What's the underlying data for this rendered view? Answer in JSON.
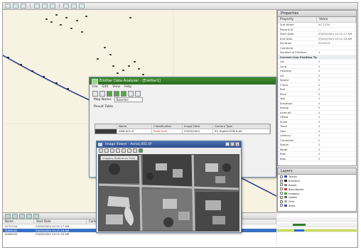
{
  "map": {
    "title": "Map view"
  },
  "props": {
    "title": "Properties",
    "col_property": "Property",
    "col_value": "Value",
    "rows": [
      {
        "k": "Sub Name",
        "v": "AC 1234",
        "sec": false
      },
      {
        "k": "Record ID",
        "v": "---",
        "sec": false
      },
      {
        "k": "Start Date",
        "v": "03/05/2004 10:21:17 AM",
        "sec": false
      },
      {
        "k": "End Date",
        "v": "03/05/2004 10:21:18 AM",
        "sec": false
      },
      {
        "k": "Duration",
        "v": "00:00:01",
        "sec": false
      },
      {
        "k": "Comment",
        "v": "",
        "sec": false
      },
      {
        "k": "Number of Emitters",
        "v": "1",
        "sec": false
      },
      {
        "k": "Current Line Position Type",
        "v": "",
        "sec": true
      },
      {
        "k": "Lat",
        "v": "0",
        "sec": false
      },
      {
        "k": "Long",
        "v": "0",
        "sec": false
      },
      {
        "k": "Heading",
        "v": "0",
        "sec": false
      },
      {
        "k": "Alt",
        "v": "0",
        "sec": false
      },
      {
        "k": "Speed",
        "v": "0",
        "sec": false
      },
      {
        "k": "Climb",
        "v": "0",
        "sec": false
      },
      {
        "k": "Roll",
        "v": "0",
        "sec": false
      },
      {
        "k": "Pitch",
        "v": "0",
        "sec": false
      },
      {
        "k": "Yaw",
        "v": "0",
        "sec": false
      },
      {
        "k": "Elevation",
        "v": "0",
        "sec": false
      },
      {
        "k": "Range",
        "v": "0",
        "sec": false
      },
      {
        "k": "Azimuth",
        "v": "0",
        "sec": false
      },
      {
        "k": "Offset",
        "v": "0",
        "sec": false
      },
      {
        "k": "Scale",
        "v": "0",
        "sec": false
      },
      {
        "k": "Track",
        "v": "0",
        "sec": false
      },
      {
        "k": "Gain",
        "v": "0",
        "sec": false
      },
      {
        "k": "Latency",
        "v": "0",
        "sec": false
      },
      {
        "k": "Correction",
        "v": "0",
        "sec": false
      },
      {
        "k": "Status",
        "v": "0",
        "sec": false
      },
      {
        "k": "Mode",
        "v": "0",
        "sec": false
      },
      {
        "k": "Bias",
        "v": "0",
        "sec": false
      },
      {
        "k": "Bias",
        "v": "0",
        "sec": false
      }
    ]
  },
  "legend": {
    "title": "Layers",
    "items": [
      {
        "label": "Tracks",
        "color": "#2a4aa8"
      },
      {
        "label": "Emitters",
        "color": "#2b2b2b"
      },
      {
        "label": "Roads",
        "color": "#888888"
      },
      {
        "label": "Boundaries",
        "color": "#c04040"
      },
      {
        "label": "Imagery",
        "color": "#4d9a3a"
      },
      {
        "label": "Labels",
        "color": "#666666"
      },
      {
        "label": "Grid",
        "color": "#aaaaaa"
      },
      {
        "label": "Sites",
        "color": "#335599"
      }
    ]
  },
  "bottom": {
    "headers": [
      "Name",
      "Start Date",
      "Comment"
    ],
    "rows": [
      {
        "cells": [
          "ACT1234",
          "03/05/2004 10:21:17 AM",
          ""
        ],
        "sel": false
      },
      {
        "cells": [
          "SUB0002",
          "03/05/2004 10:21:18 AM",
          ""
        ],
        "sel": true
      },
      {
        "cells": [
          "SUB0003",
          "03/05/2004 10:21:19 AM",
          ""
        ],
        "sel": false
      }
    ]
  },
  "dialog1": {
    "title": "Emitter Data Analyzer - [Emitter1]",
    "menu": [
      "File",
      "Edit",
      "View",
      "Help"
    ],
    "field_label": "Map Name:",
    "field_value": "Baseline",
    "section_label": "Result Table",
    "table_headers": [
      "",
      "Name",
      "Classification",
      "Image Date",
      "Camera Type"
    ],
    "table_rows": [
      [
        "",
        "AMB-001-A",
        "Restricted",
        "03/05/2004",
        "EO Digital-RGB-8-bit"
      ]
    ]
  },
  "dialog2": {
    "title": "Image Viewer - Aerial_001.tif",
    "tag_label": "Imagery Reference Point",
    "buttons": {
      "min": "_",
      "max": "□",
      "close": "×"
    }
  }
}
